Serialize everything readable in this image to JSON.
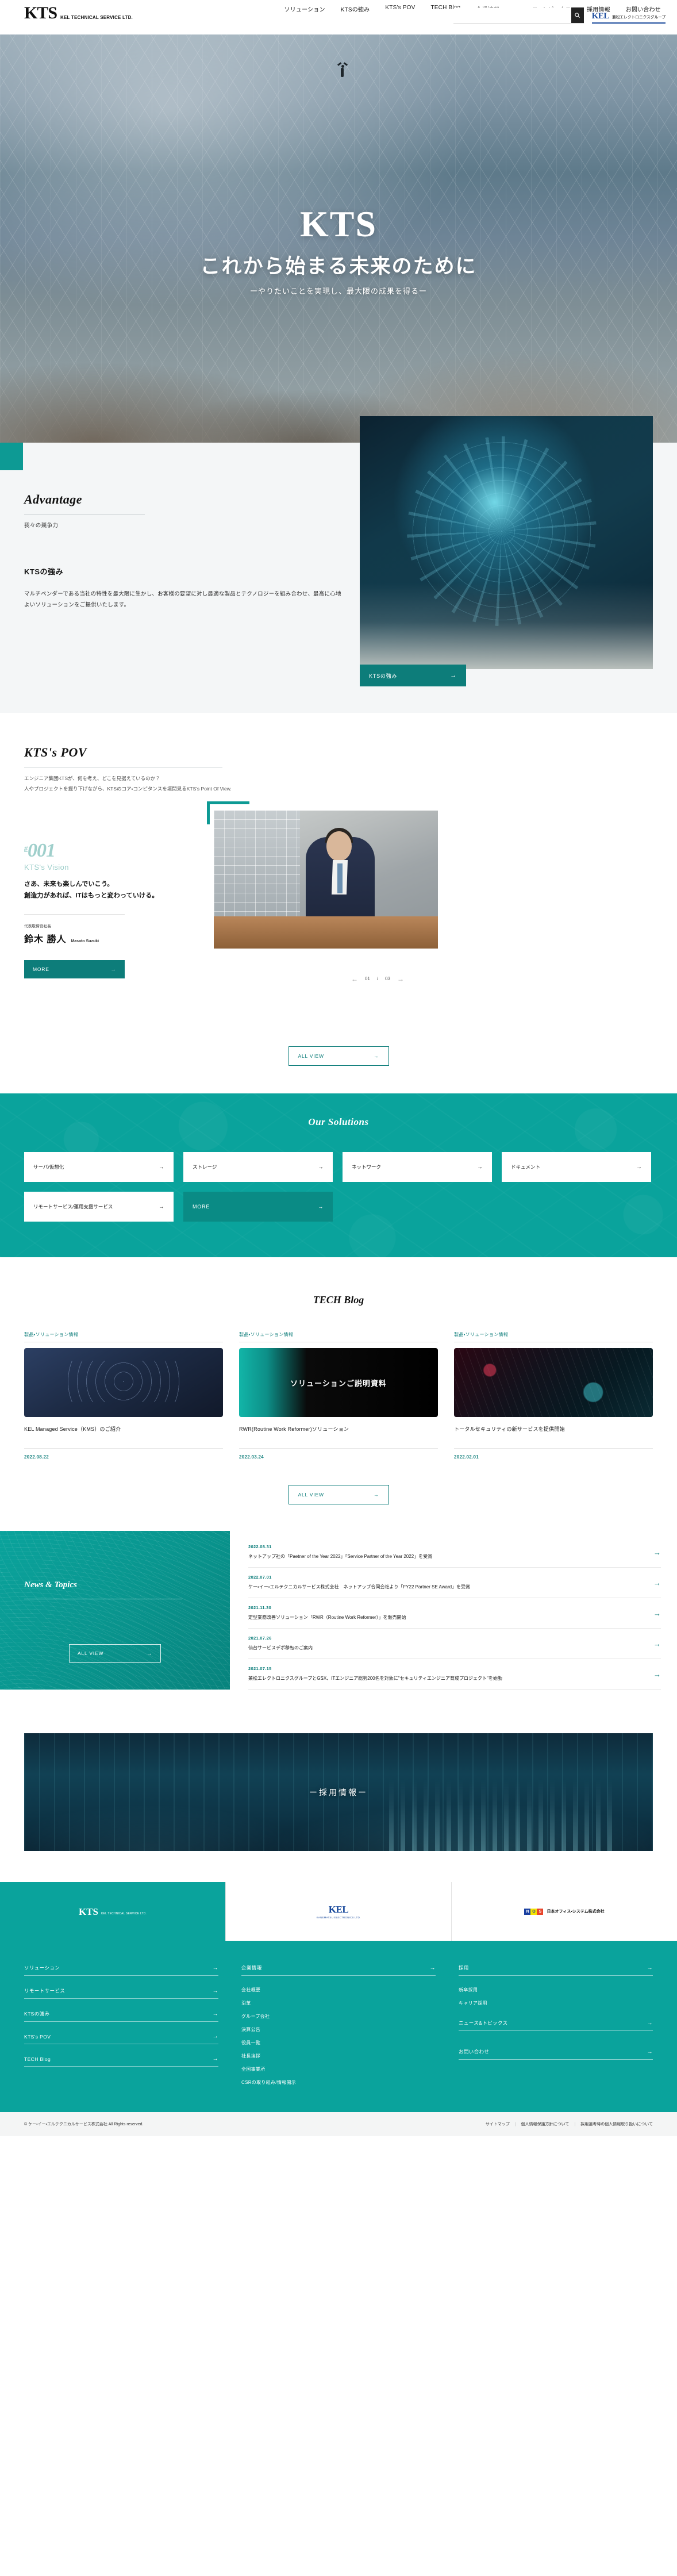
{
  "header": {
    "logo_mark": "KTS",
    "logo_text": "KEL TECHNICAL SERVICE LTD.",
    "search_placeholder": "",
    "search_value": "",
    "search_icon": "search-icon",
    "kel_logo": "KEL",
    "kel_group_label": "兼松エレクトロニクスグループ",
    "nav": [
      {
        "label": "ソリューション"
      },
      {
        "label": "KTSの強み"
      },
      {
        "label": "KTS's POV"
      },
      {
        "label": "TECH Blog"
      },
      {
        "label": "企業情報"
      },
      {
        "label": "ニュース&トピックス"
      },
      {
        "label": "採用情報"
      },
      {
        "label": "お問い合わせ"
      }
    ]
  },
  "hero": {
    "brand": "KTS",
    "title": "これから始まる未来のために",
    "subtitle": "ーやりたいことを実現し、最大限の成果を得るー"
  },
  "advantage": {
    "title": "Advantage",
    "subtitle": "我々の競争力",
    "heading": "KTSの強み",
    "body": "マルチベンダーである当社の特性を最大限に生かし、お客様の要望に対し最適な製品とテクノロジーを組み合わせ、最高に心地よいソリューションをご提供いたします。",
    "button_label": "KTSの強み",
    "button_arrow": "→"
  },
  "pov": {
    "title": "KTS's POV",
    "lead_line1": "エンジニア集団KTSが、何を考え、どこを見据えているのか？",
    "lead_line2": "人やプロジェクトを掘り下げながら、KTSのコア・コンピタンスを垣間見るKTS's Point Of View.",
    "number_hash": "#",
    "number": "001",
    "vision_label": "KTS's Vision",
    "quote_line1": "さあ、未来も楽しんでいこう。",
    "quote_line2": "創造力があれば、ITはもっと変わっていける。",
    "role": "代表取締役社長",
    "name_jp": "鈴木 勝人",
    "name_en": "Masato Suzuki",
    "more_label": "MORE",
    "more_arrow": "→",
    "pager_prev": "←",
    "pager_current": "01",
    "pager_divider": "/",
    "pager_total": "03",
    "pager_next": "→",
    "allview_label": "ALL VIEW",
    "allview_arrow": "→"
  },
  "solutions": {
    "title": "Our Solutions",
    "items": [
      {
        "label": "サーバ/仮想化",
        "arrow": "→"
      },
      {
        "label": "ストレージ",
        "arrow": "→"
      },
      {
        "label": "ネットワーク",
        "arrow": "→"
      },
      {
        "label": "ドキュメント",
        "arrow": "→"
      },
      {
        "label": "リモートサービス/運用支援サービス",
        "arrow": "→"
      }
    ],
    "more_label": "MORE",
    "more_arrow": "→"
  },
  "techblog": {
    "title": "TECH Blog",
    "cards": [
      {
        "category": "製品・ソリューション情報",
        "headline": "KEL Managed Service（KMS）のご紹介",
        "date": "2022.08.22",
        "thumb_overlay": ""
      },
      {
        "category": "製品・ソリューション情報",
        "headline": "RWR(Routine Work Reformer)ソリューション",
        "date": "2022.03.24",
        "thumb_overlay": "ソリューションご説明資料"
      },
      {
        "category": "製品・ソリューション情報",
        "headline": "トータルセキュリティの新サービスを提供開始",
        "date": "2022.02.01",
        "thumb_overlay": ""
      }
    ],
    "allview_label": "ALL VIEW",
    "allview_arrow": "→"
  },
  "news": {
    "title": "News & Topics",
    "allview_label": "ALL VIEW",
    "allview_arrow": "→",
    "items": [
      {
        "date": "2022.08.31",
        "text": "ネットアップ社の「Paetner of the Year 2022」「Service Partner of the Year 2022」を受賞",
        "arrow": "→"
      },
      {
        "date": "2022.07.01",
        "text": "ケー・イー・エルテクニカルサービス株式会社　ネットアップ合同会社より「FY22 Partner SE Award」を受賞",
        "arrow": "→"
      },
      {
        "date": "2021.11.30",
        "text": "定型業務改善ソリューション「RWR（Routine Work Reformer）」を販売開始",
        "arrow": "→"
      },
      {
        "date": "2021.07.26",
        "text": "仙台サービスデポ移転のご案内",
        "arrow": "→"
      },
      {
        "date": "2021.07.15",
        "text": "兼松エレクトロニクスグループとGSX、ITエンジニア総勢200名を対象に\"セキュリティエンジニア育成プロジェクト\"を始動",
        "arrow": "→"
      }
    ]
  },
  "recruit": {
    "label": "ー採用情報ー"
  },
  "footer_logos": {
    "kts_mark": "KTS",
    "kts_text": "KEL TECHNICAL SERVICE LTD.",
    "kel_mark": "KEL",
    "kel_text": "KANEMATSU ELECTRONICS LTD.",
    "nos_n": "N",
    "nos_o": "O",
    "nos_s": "S",
    "nos_text": "日本オフィス・システム株式会社"
  },
  "footer_nav": {
    "col1": [
      {
        "label": "ソリューション",
        "type": "head",
        "arrow": "→"
      },
      {
        "label": "リモートサービス",
        "type": "head",
        "arrow": "→"
      },
      {
        "label": "KTSの強み",
        "type": "head",
        "arrow": "→"
      },
      {
        "label": "KTS's POV",
        "type": "head",
        "arrow": "→"
      },
      {
        "label": "TECH Blog",
        "type": "head",
        "arrow": "→"
      }
    ],
    "col2_head": {
      "label": "企業情報",
      "arrow": "→"
    },
    "col2": [
      {
        "label": "会社概要"
      },
      {
        "label": "沿革"
      },
      {
        "label": "グループ会社"
      },
      {
        "label": "決算公告"
      },
      {
        "label": "役員一覧"
      },
      {
        "label": "社長挨拶"
      },
      {
        "label": "全国事業所"
      },
      {
        "label": "CSRの取り組み/情報開示"
      }
    ],
    "col3_head": {
      "label": "採用",
      "arrow": "→"
    },
    "col3": [
      {
        "label": "新卒採用"
      },
      {
        "label": "キャリア採用"
      }
    ],
    "col3_head2": {
      "label": "ニュース&トピックス",
      "arrow": "→"
    },
    "col3_head3": {
      "label": "お問い合わせ",
      "arrow": "→"
    }
  },
  "copyright": {
    "text": "© ケー・イー・エルテクニカルサービス株式会社 All Rights reserved.",
    "links": [
      {
        "label": "サイトマップ"
      },
      {
        "label": "個人情報保護方針について"
      },
      {
        "label": "採用選考時の個人情報取り扱いについて"
      }
    ],
    "separator": "|"
  },
  "colors": {
    "teal": "#0aa39c",
    "teal_dark": "#0d7d7a",
    "kel_blue": "#1a4a9c"
  }
}
